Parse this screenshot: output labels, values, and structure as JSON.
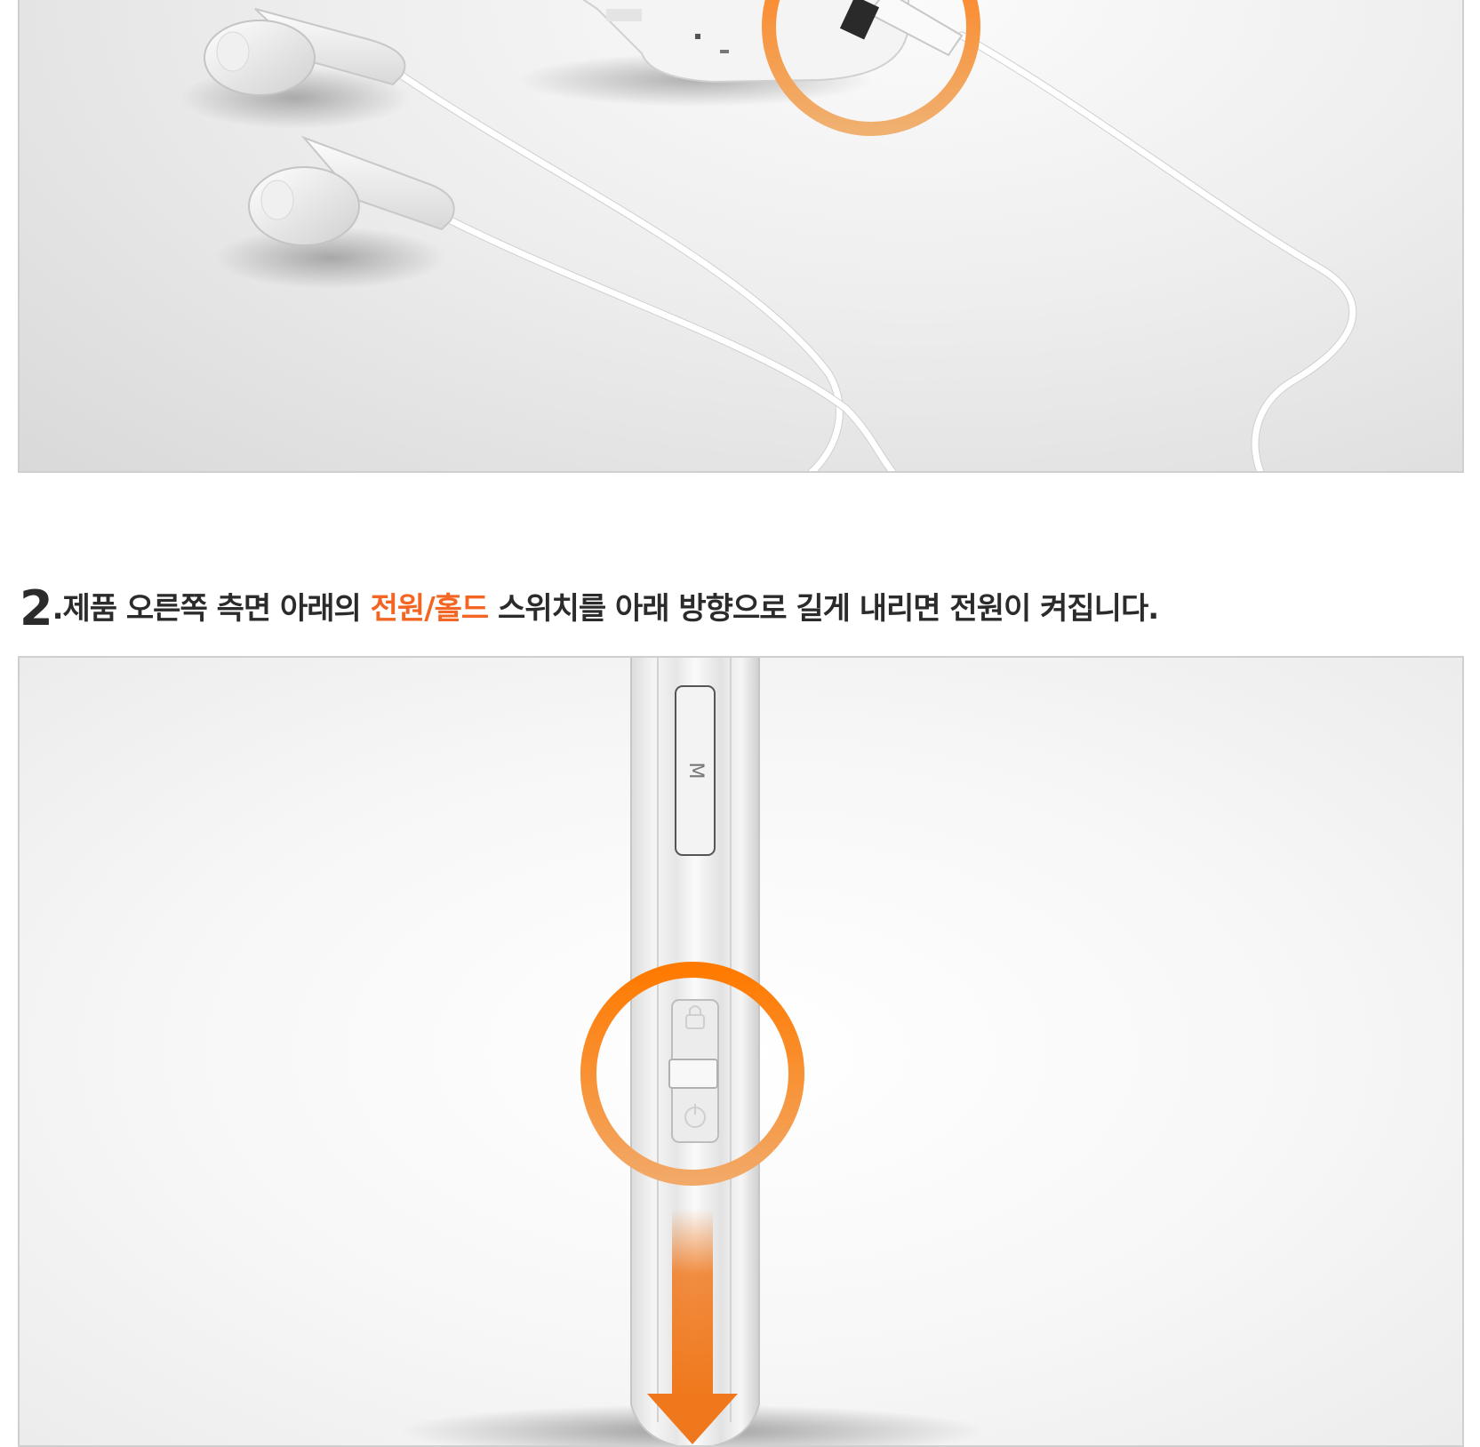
{
  "step": {
    "number": "2",
    "dot": ".",
    "text_before": "제품 오른쪽 측면 아래의 ",
    "text_highlight": "전원/홀드",
    "text_after": " 스위치를 아래 방향으로 길게 내리면 전원이 켜집니다."
  },
  "device": {
    "m_button_label": "M"
  },
  "colors": {
    "accent": "#f26522",
    "text": "#2b2b2b",
    "panel_border": "#cfcfcf"
  },
  "icons": {
    "highlight_circle": "orange-highlight-circle-icon",
    "arrow": "down-arrow-icon",
    "lock": "lock-icon",
    "power": "power-icon"
  }
}
